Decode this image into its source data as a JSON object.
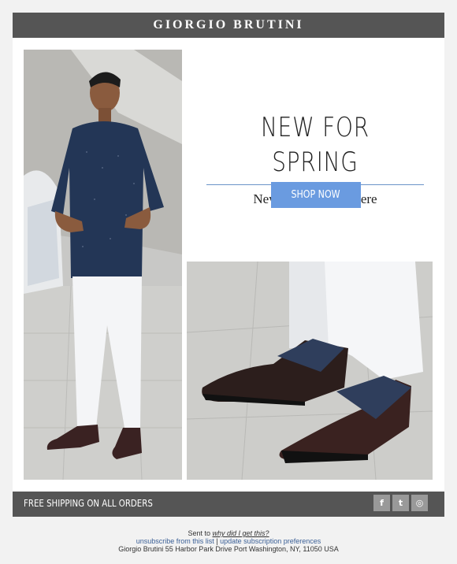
{
  "header": {
    "brand": "GIORGIO BRUTINI"
  },
  "hero": {
    "headline": "NEW FOR SPRING",
    "subhead": "New Arrivals Are Here",
    "cta_label": "SHOP NOW"
  },
  "footer_bar": {
    "shipping": "FREE SHIPPING ON ALL ORDERS",
    "social": [
      {
        "icon": "facebook-icon",
        "glyph": "f"
      },
      {
        "icon": "twitter-icon",
        "glyph": "t"
      },
      {
        "icon": "instagram-icon",
        "glyph": "◎"
      }
    ]
  },
  "fine_print": {
    "sent_to": "Sent to",
    "why_link": "why did I get this?",
    "unsubscribe": "unsubscribe from this list",
    "separator": "|",
    "update_prefs": "update subscription preferences",
    "address": "Giorgio Brutini 55 Harbor Park Drive Port Washington, NY, 11050 USA"
  },
  "colors": {
    "bar": "#555555",
    "accent": "#6a9be0",
    "rule": "#6a93c8"
  }
}
